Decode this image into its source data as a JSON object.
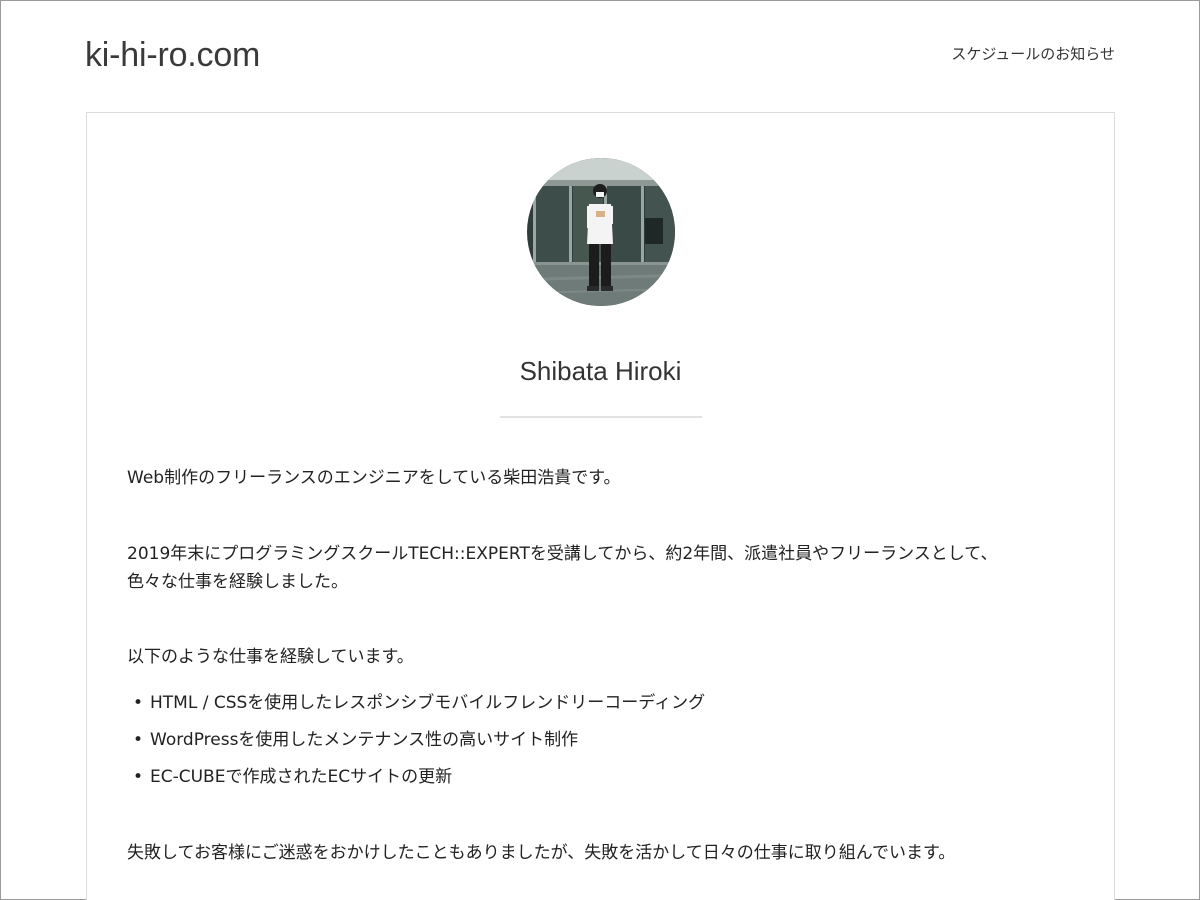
{
  "header": {
    "site_title": "ki-hi-ro.com",
    "nav_items": [
      {
        "label": "スケジュールのお知らせ"
      }
    ]
  },
  "profile": {
    "photo_icon": "profile-photo",
    "name": "Shibata Hiroki"
  },
  "content": {
    "intro": "Web制作のフリーランスのエンジニアをしている柴田浩貴です。",
    "history_line1": "2019年末にプログラミングスクールTECH::EXPERTを受講してから、約2年間、派遣社員やフリーランスとして、",
    "history_line2": "色々な仕事を経験しました。",
    "experience_intro": "以下のような仕事を経験しています。",
    "experience_items": [
      "HTML / CSSを使用したレスポンシブモバイルフレンドリーコーディング",
      "WordPressを使用したメンテナンス性の高いサイト制作",
      "EC-CUBEで作成されたECサイトの更新"
    ],
    "closing": "失敗してお客様にご迷惑をおかけしたこともありましたが、失敗を活かして日々の仕事に取り組んでいます。"
  },
  "colors": {
    "text": "#333333",
    "border": "#dcdcdc",
    "divider": "#e2e2e2"
  }
}
